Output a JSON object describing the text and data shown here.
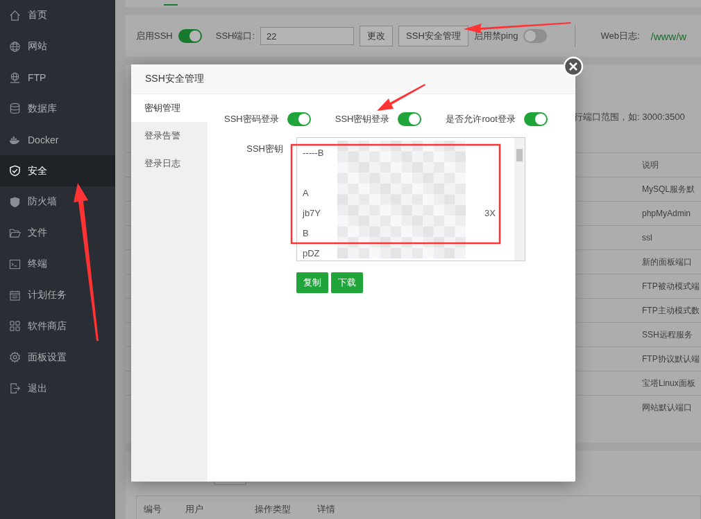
{
  "sidebar": {
    "items": [
      {
        "label": "首页",
        "selected": false
      },
      {
        "label": "网站",
        "selected": false
      },
      {
        "label": "FTP",
        "selected": false
      },
      {
        "label": "数据库",
        "selected": false
      },
      {
        "label": "Docker",
        "selected": false
      },
      {
        "label": "安全",
        "selected": true
      },
      {
        "label": "防火墙",
        "selected": false
      },
      {
        "label": "文件",
        "selected": false
      },
      {
        "label": "终端",
        "selected": false
      },
      {
        "label": "计划任务",
        "selected": false
      },
      {
        "label": "软件商店",
        "selected": false
      },
      {
        "label": "面板设置",
        "selected": false
      },
      {
        "label": "退出",
        "selected": false
      }
    ]
  },
  "ssh_bar": {
    "ssh_label": "启用SSH",
    "ssh_on": true,
    "port_label": "SSH端口:",
    "port_value": "22",
    "change_button": "更改",
    "manage_button": "SSH安全管理",
    "ping_label": "启用禁ping",
    "ping_on": false,
    "web_log_label": "Web日志:",
    "web_log_path": "/www/w"
  },
  "firewall": {
    "hint": "行端口范围，如: 3000:3500",
    "column": "说明",
    "rows": [
      "MySQL服务默",
      "phpMyAdmin",
      "ssl",
      "新的面板端口",
      "FTP被动模式端",
      "FTP主动模式数",
      "SSH远程服务",
      "FTP协议默认端",
      "宝塔Linux面板",
      "网站默认端口"
    ]
  },
  "log_table": {
    "columns": [
      "编号",
      "用户",
      "操作类型",
      "详情"
    ]
  },
  "modal": {
    "title": "SSH安全管理",
    "tabs": [
      {
        "label": "密钥管理",
        "selected": true
      },
      {
        "label": "登录告警",
        "selected": false
      },
      {
        "label": "登录日志",
        "selected": false
      }
    ],
    "switches": [
      {
        "label": "SSH密码登录",
        "on": true
      },
      {
        "label": "SSH密钥登录",
        "on": true
      },
      {
        "label": "是否允许root登录",
        "on": true
      }
    ],
    "key_label": "SSH密钥",
    "key_lines": [
      {
        "text": "-----B"
      },
      {
        "text": "A"
      },
      {
        "text": "jb7Y",
        "end": "3X"
      },
      {
        "text": "B"
      },
      {
        "text": "pDZ"
      }
    ],
    "buttons": [
      "复制",
      "下载"
    ]
  }
}
